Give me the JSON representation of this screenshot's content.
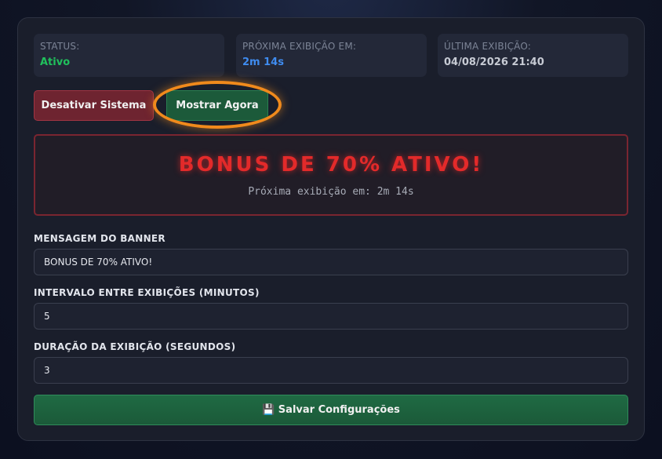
{
  "status": {
    "status_label": "STATUS:",
    "status_value": "Ativo",
    "next_label": "PRÓXIMA EXIBIÇÃO EM:",
    "next_value": "2m 14s",
    "last_label": "ÚLTIMA EXIBIÇÃO:",
    "last_value": "04/08/2026 21:40"
  },
  "actions": {
    "deactivate_label": "Desativar Sistema",
    "show_now_label": "Mostrar Agora"
  },
  "preview": {
    "title": "BONUS DE 70% ATIVO!",
    "subtitle": "Próxima exibição em: 2m 14s"
  },
  "form": {
    "message_label": "MENSAGEM DO BANNER",
    "message_value": "BONUS DE 70% ATIVO!",
    "interval_label": "INTERVALO ENTRE EXIBIÇÕES (MINUTOS)",
    "interval_value": "5",
    "duration_label": "DURAÇÃO DA EXIBIÇÃO (SEGUNDOS)",
    "duration_value": "3",
    "save_label": "💾 Salvar Configurações"
  },
  "colors": {
    "active_green": "#20c05c",
    "countdown_blue": "#3f8cf0",
    "banner_red": "#e32a2a",
    "highlight_orange": "#f08a1c"
  }
}
